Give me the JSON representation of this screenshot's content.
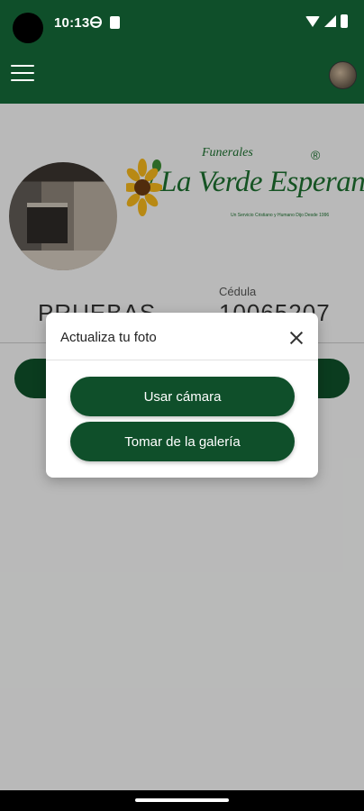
{
  "status_bar": {
    "time": "10:13",
    "icons": [
      "globe-icon",
      "sim-card-icon",
      "wifi-icon",
      "signal-icon",
      "battery-icon"
    ]
  },
  "app_bar": {
    "menu_icon": "hamburger-menu-icon",
    "avatar": "user-avatar"
  },
  "profile": {
    "name": "PRUEBAS",
    "cedula_label": "Cédula",
    "cedula_value": "10065207"
  },
  "brand": {
    "top_text": "Funerales",
    "name": "La Verde Esperanza",
    "registered": "®",
    "tagline": "Un Servicio Cristiano y Humano Dijo Desde 1996"
  },
  "dialog": {
    "title": "Actualiza tu foto",
    "camera_button": "Usar cámara",
    "gallery_button": "Tomar de la galería"
  },
  "colors": {
    "primary": "#0f4f2a",
    "brand_green": "#1c6e2f",
    "scrim": "rgba(0,0,0,0.24)"
  }
}
